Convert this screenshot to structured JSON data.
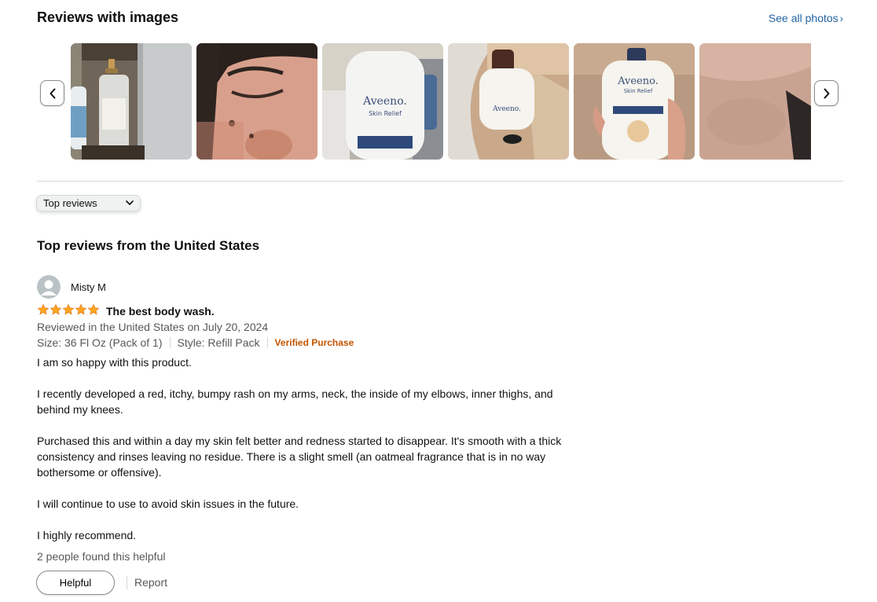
{
  "images_section": {
    "title": "Reviews with images",
    "see_all_label": "See all photos",
    "thumbnails": [
      {
        "name": "bathroom-shelf-bottles-photo",
        "brand": ""
      },
      {
        "name": "face-closeup-photo",
        "brand": ""
      },
      {
        "name": "bottle-in-sink-photo",
        "brand": "Aveeno.",
        "subtitle": "Skin Relief"
      },
      {
        "name": "small-bottle-tub-photo",
        "brand": "Aveeno."
      },
      {
        "name": "hand-holding-bottle-photo",
        "brand": "Aveeno.",
        "subtitle": "Skin Relief"
      },
      {
        "name": "skin-closeup-photo",
        "brand": ""
      }
    ]
  },
  "sort": {
    "selected": "Top reviews"
  },
  "reviews_section": {
    "title": "Top reviews from the United States"
  },
  "review": {
    "reviewer": "Misty M",
    "rating": 5,
    "title": "The best body wash.",
    "date_line": "Reviewed in the United States on July 20, 2024",
    "size": "Size: 36 Fl Oz (Pack of 1)",
    "style": "Style: Refill Pack",
    "verified": "Verified Purchase",
    "body": [
      "I am so happy with this product.",
      "I recently developed a red, itchy, bumpy rash on my arms, neck, the inside of my elbows, inner thighs, and behind my knees.",
      "Purchased this and within a day my skin felt better and redness started to disappear. It's smooth with a thick consistency and rinses leaving no residue. There is a slight smell (an oatmeal fragrance that is in no way bothersome or offensive).",
      "I will continue to use to avoid skin issues in the future.",
      "I highly recommend."
    ],
    "helpful_count": "2 people found this helpful",
    "helpful_label": "Helpful",
    "report_label": "Report"
  },
  "colors": {
    "link": "#2162a1",
    "star": "#ffa41c",
    "verified": "#c45500",
    "muted": "#565959"
  }
}
